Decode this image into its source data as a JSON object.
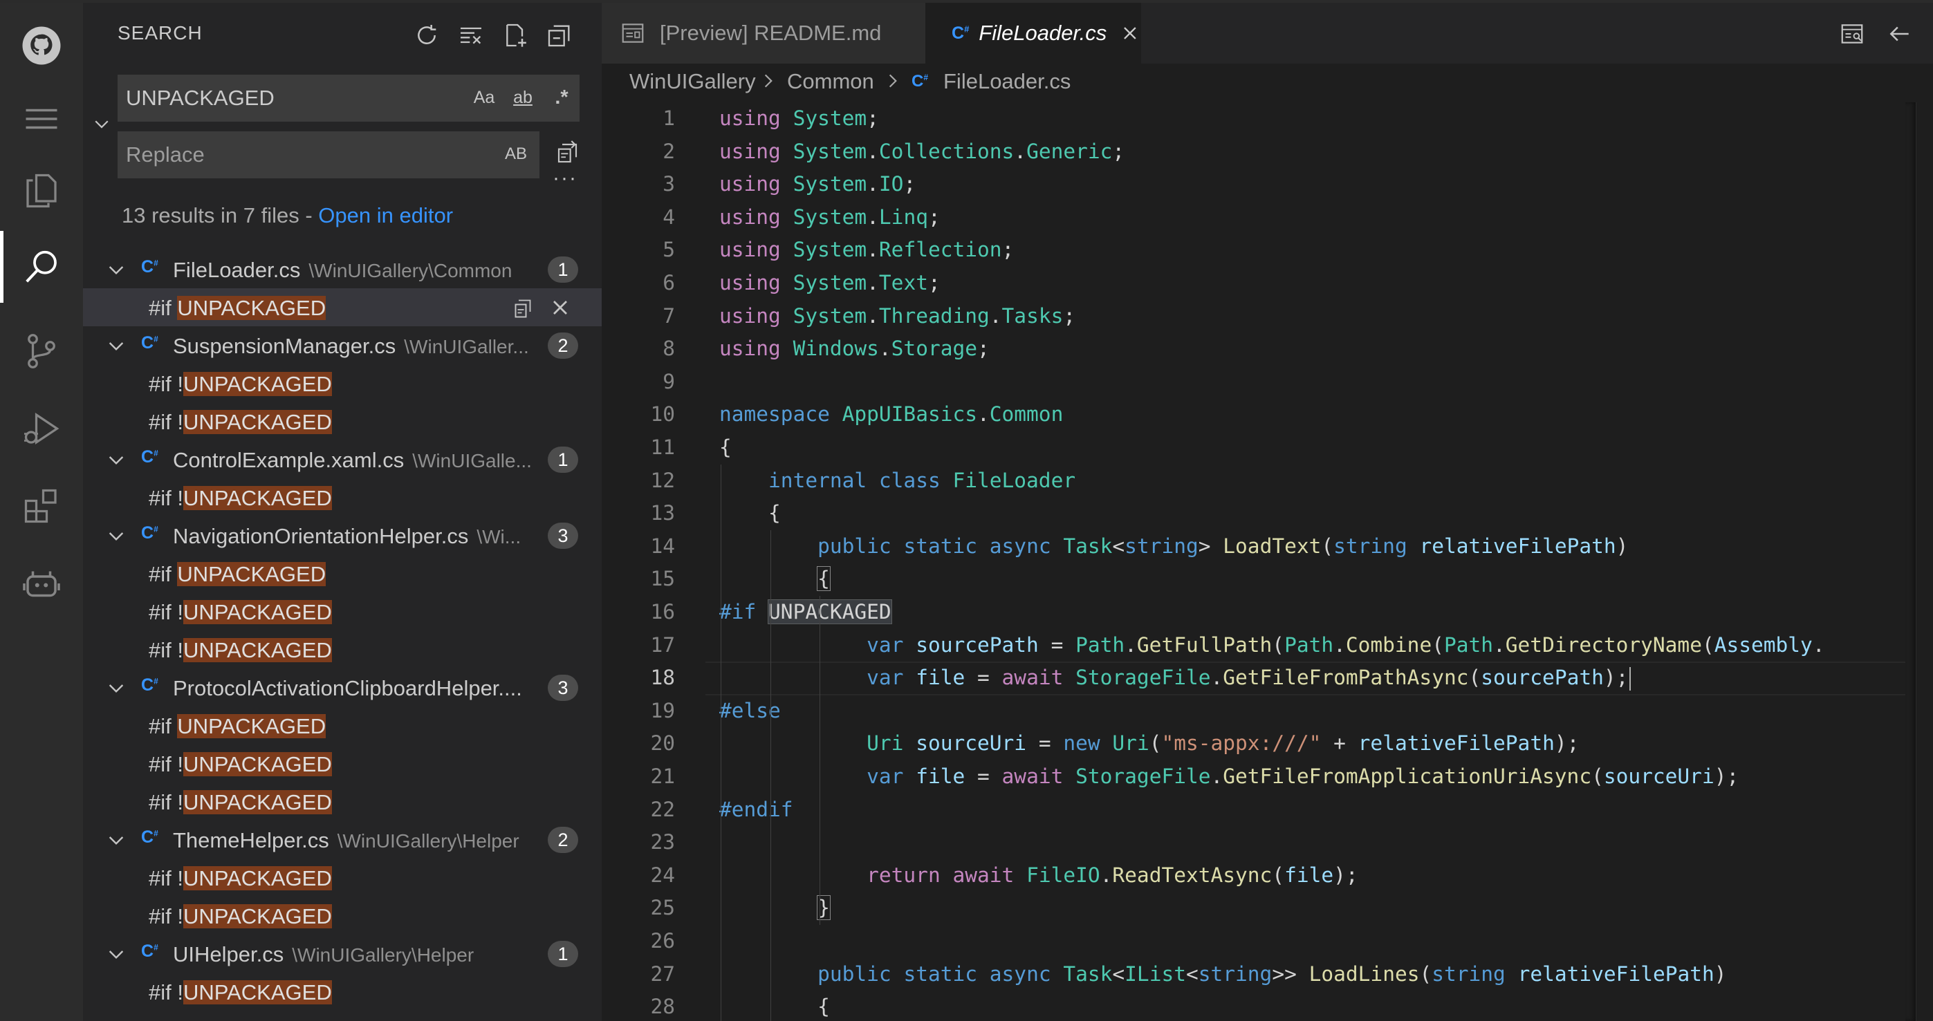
{
  "activity_bar": {
    "items": [
      "github-account",
      "menu",
      "explorer",
      "search",
      "source-control",
      "run-and-debug",
      "extensions",
      "copilot"
    ],
    "active": "search"
  },
  "sidebar": {
    "title": "SEARCH",
    "search_value": "UNPACKAGED",
    "replace_placeholder": "Replace",
    "options": {
      "match_case": "Aa",
      "whole_word": "ab",
      "regex": ".*",
      "preserve_case": "AB"
    },
    "summary_text": "13 results in 7 files - ",
    "summary_link": "Open in editor",
    "results": [
      {
        "file": "FileLoader.cs",
        "path": "\\WinUIGallery\\Common",
        "count": "1",
        "matches": [
          {
            "prefix": "#if ",
            "match": "UNPACKAGED"
          }
        ]
      },
      {
        "file": "SuspensionManager.cs",
        "path": "\\WinUIGaller...",
        "count": "2",
        "matches": [
          {
            "prefix": "#if !",
            "match": "UNPACKAGED"
          },
          {
            "prefix": "#if !",
            "match": "UNPACKAGED"
          }
        ]
      },
      {
        "file": "ControlExample.xaml.cs",
        "path": "\\WinUIGalle...",
        "count": "1",
        "matches": [
          {
            "prefix": "#if !",
            "match": "UNPACKAGED"
          }
        ]
      },
      {
        "file": "NavigationOrientationHelper.cs",
        "path": "\\Wi...",
        "count": "3",
        "matches": [
          {
            "prefix": "#if ",
            "match": "UNPACKAGED"
          },
          {
            "prefix": "#if !",
            "match": "UNPACKAGED"
          },
          {
            "prefix": "#if !",
            "match": "UNPACKAGED"
          }
        ]
      },
      {
        "file": "ProtocolActivationClipboardHelper....",
        "path": "",
        "count": "3",
        "matches": [
          {
            "prefix": "#if ",
            "match": "UNPACKAGED"
          },
          {
            "prefix": "#if !",
            "match": "UNPACKAGED"
          },
          {
            "prefix": "#if !",
            "match": "UNPACKAGED"
          }
        ]
      },
      {
        "file": "ThemeHelper.cs",
        "path": "\\WinUIGallery\\Helper",
        "count": "2",
        "matches": [
          {
            "prefix": "#if !",
            "match": "UNPACKAGED"
          },
          {
            "prefix": "#if !",
            "match": "UNPACKAGED"
          }
        ]
      },
      {
        "file": "UIHelper.cs",
        "path": "\\WinUIGallery\\Helper",
        "count": "1",
        "matches": [
          {
            "prefix": "#if !",
            "match": "UNPACKAGED"
          }
        ]
      }
    ]
  },
  "tabs": [
    {
      "label": "[Preview] README.md",
      "active": false
    },
    {
      "label": "FileLoader.cs",
      "active": true
    }
  ],
  "breadcrumb": [
    "WinUIGallery",
    "Common",
    "FileLoader.cs"
  ],
  "editor": {
    "current_line": 18,
    "lines": [
      [
        [
          "kw2",
          "using"
        ],
        [
          "pl",
          " "
        ],
        [
          "ty",
          "System"
        ],
        [
          "pl",
          ";"
        ]
      ],
      [
        [
          "kw2",
          "using"
        ],
        [
          "pl",
          " "
        ],
        [
          "ty",
          "System"
        ],
        [
          "pl",
          "."
        ],
        [
          "ty",
          "Collections"
        ],
        [
          "pl",
          "."
        ],
        [
          "ty",
          "Generic"
        ],
        [
          "pl",
          ";"
        ]
      ],
      [
        [
          "kw2",
          "using"
        ],
        [
          "pl",
          " "
        ],
        [
          "ty",
          "System"
        ],
        [
          "pl",
          "."
        ],
        [
          "ty",
          "IO"
        ],
        [
          "pl",
          ";"
        ]
      ],
      [
        [
          "kw2",
          "using"
        ],
        [
          "pl",
          " "
        ],
        [
          "ty",
          "System"
        ],
        [
          "pl",
          "."
        ],
        [
          "ty",
          "Linq"
        ],
        [
          "pl",
          ";"
        ]
      ],
      [
        [
          "kw2",
          "using"
        ],
        [
          "pl",
          " "
        ],
        [
          "ty",
          "System"
        ],
        [
          "pl",
          "."
        ],
        [
          "ty",
          "Reflection"
        ],
        [
          "pl",
          ";"
        ]
      ],
      [
        [
          "kw2",
          "using"
        ],
        [
          "pl",
          " "
        ],
        [
          "ty",
          "System"
        ],
        [
          "pl",
          "."
        ],
        [
          "ty",
          "Text"
        ],
        [
          "pl",
          ";"
        ]
      ],
      [
        [
          "kw2",
          "using"
        ],
        [
          "pl",
          " "
        ],
        [
          "ty",
          "System"
        ],
        [
          "pl",
          "."
        ],
        [
          "ty",
          "Threading"
        ],
        [
          "pl",
          "."
        ],
        [
          "ty",
          "Tasks"
        ],
        [
          "pl",
          ";"
        ]
      ],
      [
        [
          "kw2",
          "using"
        ],
        [
          "pl",
          " "
        ],
        [
          "ty",
          "Windows"
        ],
        [
          "pl",
          "."
        ],
        [
          "ty",
          "Storage"
        ],
        [
          "pl",
          ";"
        ]
      ],
      [],
      [
        [
          "k",
          "namespace"
        ],
        [
          "pl",
          " "
        ],
        [
          "ty",
          "AppUIBasics"
        ],
        [
          "pl",
          "."
        ],
        [
          "ty",
          "Common"
        ]
      ],
      [
        [
          "pl",
          "{"
        ]
      ],
      [
        [
          "pl",
          "    "
        ],
        [
          "k",
          "internal"
        ],
        [
          "pl",
          " "
        ],
        [
          "k",
          "class"
        ],
        [
          "pl",
          " "
        ],
        [
          "ty",
          "FileLoader"
        ]
      ],
      [
        [
          "pl",
          "    {"
        ]
      ],
      [
        [
          "pl",
          "        "
        ],
        [
          "k",
          "public"
        ],
        [
          "pl",
          " "
        ],
        [
          "k",
          "static"
        ],
        [
          "pl",
          " "
        ],
        [
          "k",
          "async"
        ],
        [
          "pl",
          " "
        ],
        [
          "ty",
          "Task"
        ],
        [
          "pl",
          "<"
        ],
        [
          "k",
          "string"
        ],
        [
          "pl",
          "> "
        ],
        [
          "fn",
          "LoadText"
        ],
        [
          "pl",
          "("
        ],
        [
          "k",
          "string"
        ],
        [
          "pl",
          " "
        ],
        [
          "va",
          "relativeFilePath"
        ],
        [
          "pl",
          ")"
        ]
      ],
      [
        [
          "pl",
          "        "
        ],
        [
          "brk",
          "{"
        ]
      ],
      [
        [
          "pp",
          "#if "
        ],
        [
          "sel",
          "UNPACKAGED"
        ]
      ],
      [
        [
          "pl",
          "            "
        ],
        [
          "k",
          "var"
        ],
        [
          "pl",
          " "
        ],
        [
          "va",
          "sourcePath"
        ],
        [
          "pl",
          " = "
        ],
        [
          "ty",
          "Path"
        ],
        [
          "pl",
          "."
        ],
        [
          "fn",
          "GetFullPath"
        ],
        [
          "pl",
          "("
        ],
        [
          "ty",
          "Path"
        ],
        [
          "pl",
          "."
        ],
        [
          "fn",
          "Combine"
        ],
        [
          "pl",
          "("
        ],
        [
          "ty",
          "Path"
        ],
        [
          "pl",
          "."
        ],
        [
          "fn",
          "GetDirectoryName"
        ],
        [
          "pl",
          "("
        ],
        [
          "va",
          "Assembly"
        ],
        [
          "pl",
          "."
        ]
      ],
      [
        [
          "pl",
          "            "
        ],
        [
          "k",
          "var"
        ],
        [
          "pl",
          " "
        ],
        [
          "va",
          "file"
        ],
        [
          "pl",
          " = "
        ],
        [
          "kw2",
          "await"
        ],
        [
          "pl",
          " "
        ],
        [
          "ty",
          "StorageFile"
        ],
        [
          "pl",
          "."
        ],
        [
          "fn",
          "GetFileFromPathAsync"
        ],
        [
          "pl",
          "("
        ],
        [
          "va",
          "sourcePath"
        ],
        [
          "pl",
          ");"
        ]
      ],
      [
        [
          "pp",
          "#else"
        ]
      ],
      [
        [
          "pl",
          "            "
        ],
        [
          "ty",
          "Uri"
        ],
        [
          "pl",
          " "
        ],
        [
          "va",
          "sourceUri"
        ],
        [
          "pl",
          " = "
        ],
        [
          "k",
          "new"
        ],
        [
          "pl",
          " "
        ],
        [
          "ty",
          "Uri"
        ],
        [
          "pl",
          "("
        ],
        [
          "st",
          "\"ms-appx:///\""
        ],
        [
          "pl",
          " + "
        ],
        [
          "va",
          "relativeFilePath"
        ],
        [
          "pl",
          ");"
        ]
      ],
      [
        [
          "pl",
          "            "
        ],
        [
          "k",
          "var"
        ],
        [
          "pl",
          " "
        ],
        [
          "va",
          "file"
        ],
        [
          "pl",
          " = "
        ],
        [
          "kw2",
          "await"
        ],
        [
          "pl",
          " "
        ],
        [
          "ty",
          "StorageFile"
        ],
        [
          "pl",
          "."
        ],
        [
          "fn",
          "GetFileFromApplicationUriAsync"
        ],
        [
          "pl",
          "("
        ],
        [
          "va",
          "sourceUri"
        ],
        [
          "pl",
          ");"
        ]
      ],
      [
        [
          "pp",
          "#endif"
        ]
      ],
      [],
      [
        [
          "pl",
          "            "
        ],
        [
          "kw2",
          "return"
        ],
        [
          "pl",
          " "
        ],
        [
          "kw2",
          "await"
        ],
        [
          "pl",
          " "
        ],
        [
          "ty",
          "FileIO"
        ],
        [
          "pl",
          "."
        ],
        [
          "fn",
          "ReadTextAsync"
        ],
        [
          "pl",
          "("
        ],
        [
          "va",
          "file"
        ],
        [
          "pl",
          ");"
        ]
      ],
      [
        [
          "pl",
          "        "
        ],
        [
          "brk",
          "}"
        ]
      ],
      [],
      [
        [
          "pl",
          "        "
        ],
        [
          "k",
          "public"
        ],
        [
          "pl",
          " "
        ],
        [
          "k",
          "static"
        ],
        [
          "pl",
          " "
        ],
        [
          "k",
          "async"
        ],
        [
          "pl",
          " "
        ],
        [
          "ty",
          "Task"
        ],
        [
          "pl",
          "<"
        ],
        [
          "ty",
          "IList"
        ],
        [
          "pl",
          "<"
        ],
        [
          "k",
          "string"
        ],
        [
          "pl",
          ">> "
        ],
        [
          "fn",
          "LoadLines"
        ],
        [
          "pl",
          "("
        ],
        [
          "k",
          "string"
        ],
        [
          "pl",
          " "
        ],
        [
          "va",
          "relativeFilePath"
        ],
        [
          "pl",
          ")"
        ]
      ],
      [
        [
          "pl",
          "        {"
        ]
      ]
    ]
  },
  "colors": {
    "accent": "#3794ff",
    "match_highlight": "#7d3c1c",
    "activity_bar": "#2c2c2c",
    "sidebar": "#252526",
    "editor": "#1e1e1e"
  }
}
